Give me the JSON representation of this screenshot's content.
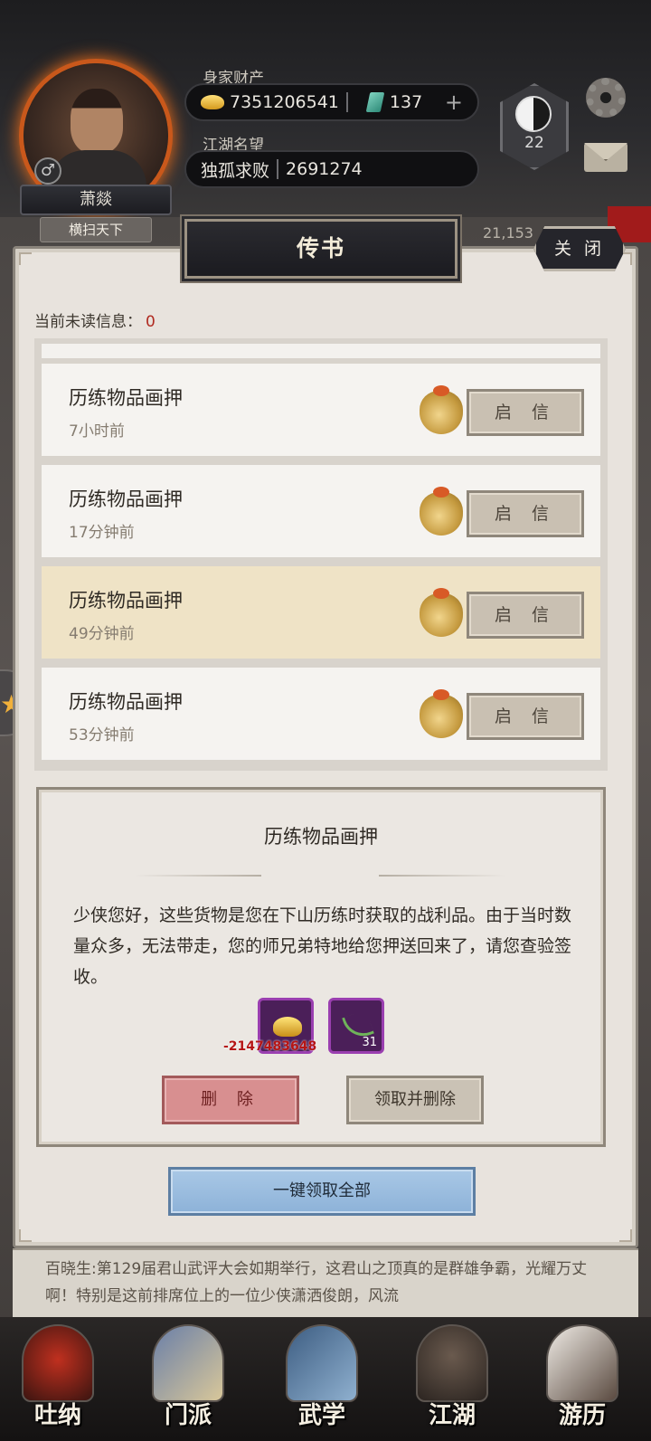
{
  "player": {
    "name": "萧燚",
    "title": "横扫天下",
    "gender_symbol": "♂"
  },
  "resources": {
    "wealth_label": "身家财产",
    "gold": "7351206541",
    "jade": "137",
    "plus": "+",
    "fame_label": "江湖名望",
    "fame_title": "独孤求败",
    "fame_value": "2691274"
  },
  "badge": {
    "level": "22"
  },
  "background": {
    "number": "21,153"
  },
  "modal": {
    "title": "传书",
    "close_label": "关 闭",
    "unread_label": "当前未读信息：",
    "unread_count": "0",
    "mails": [
      {
        "title": "历练物品画押",
        "time": "7小时前",
        "button": "启 信"
      },
      {
        "title": "历练物品画押",
        "time": "17分钟前",
        "button": "启 信"
      },
      {
        "title": "历练物品画押",
        "time": "49分钟前",
        "button": "启 信"
      },
      {
        "title": "历练物品画押",
        "time": "53分钟前",
        "button": "启 信"
      }
    ],
    "detail": {
      "title": "历练物品画押",
      "body": "少侠您好，这些货物是您在下山历练时获取的战利品。由于当时数量众多，无法带走，您的师兄弟特地给您押送回来了，请您查验签收。",
      "reward_gold_amount": "-2147483648",
      "reward_herb_count": "31",
      "delete_label": "删 除",
      "claim_delete_label": "领取并删除"
    },
    "claim_all_label": "一键领取全部"
  },
  "news": {
    "text": "百晓生:第129届君山武评大会如期举行，这君山之顶真的是群雄争霸，光耀万丈啊！特别是这前排席位上的一位少侠潇洒俊朗，风流"
  },
  "nav": [
    {
      "label": "吐纳",
      "icon": "meditation-icon"
    },
    {
      "label": "门派",
      "icon": "sect-icon"
    },
    {
      "label": "武学",
      "icon": "martial-arts-icon"
    },
    {
      "label": "江湖",
      "icon": "jianghu-icon"
    },
    {
      "label": "游历",
      "icon": "travel-icon"
    }
  ],
  "colors": {
    "unread_count": "#b02a20",
    "selected_row": "#efe3c6",
    "claim_all": "#8db2d8",
    "delete": "#d88f90"
  }
}
